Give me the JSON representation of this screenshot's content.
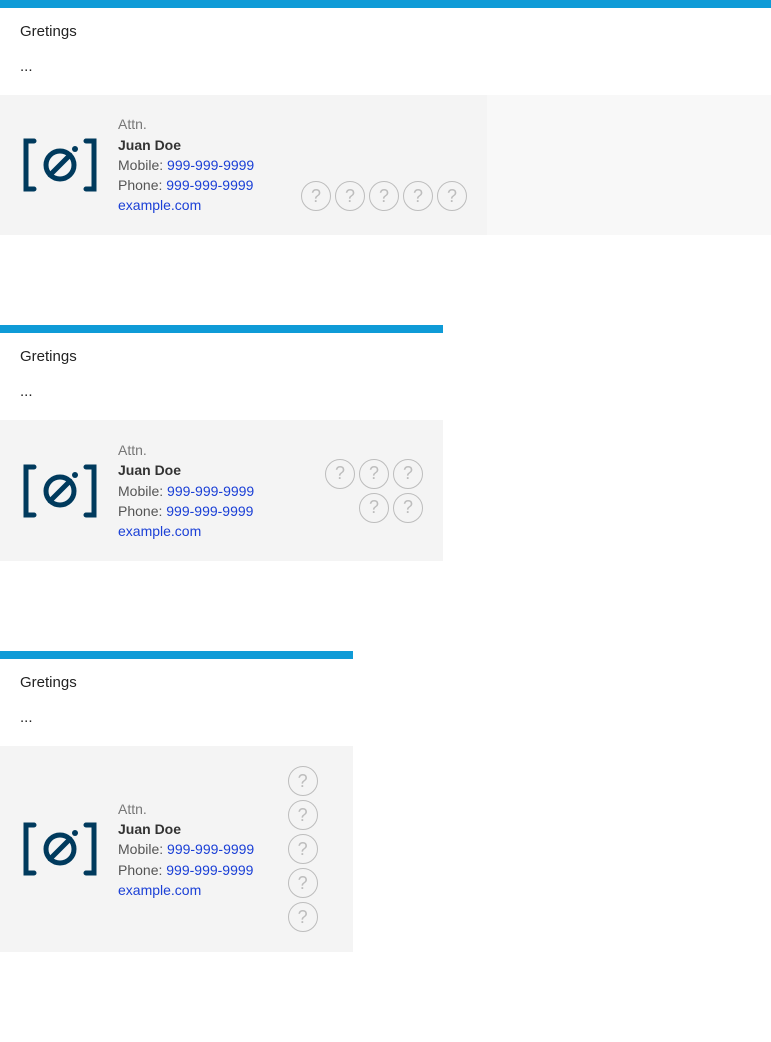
{
  "greeting": "Gretings",
  "body_placeholder": "...",
  "signature": {
    "attn": "Attn.",
    "name": "Juan Doe",
    "mobile_label": "Mobile: ",
    "mobile_value": "999-999-9999",
    "phone_label": "Phone: ",
    "phone_value": "999-999-9999",
    "website": "example.com"
  },
  "icon_glyph": "?",
  "colors": {
    "brand": "#0f9bd7",
    "logo": "#003a5d",
    "link": "#1a3fd6"
  }
}
